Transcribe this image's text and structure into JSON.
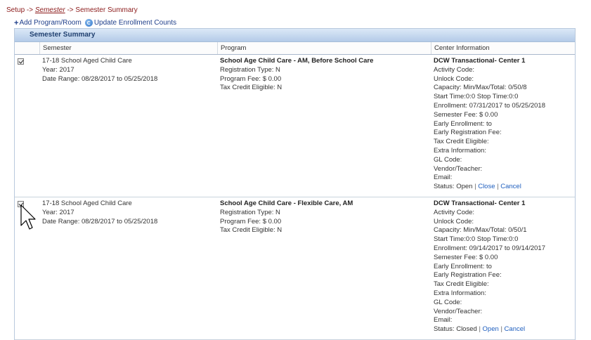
{
  "breadcrumb": {
    "setup": "Setup",
    "sep1": "->",
    "semester": "Semester",
    "sep2": "->",
    "current": "Semester Summary"
  },
  "actions": {
    "add_program": "Add Program/Room",
    "update_counts": "Update Enrollment Counts"
  },
  "panel": {
    "title": "Semester Summary"
  },
  "columns": {
    "semester": "Semester",
    "program": "Program",
    "center": "Center Information"
  },
  "rows": [
    {
      "checked": true,
      "semester": {
        "name": "17-18 School Aged Child Care",
        "year": "Year: 2017",
        "date_range": "Date Range: 08/28/2017 to 05/25/2018"
      },
      "program": {
        "name": "School Age Child Care - AM, Before School Care",
        "registration_type": "Registration Type: N",
        "program_fee": "Program Fee: $ 0.00",
        "tax_credit": "Tax Credit Eligible: N"
      },
      "center": {
        "name": "DCW Transactional- Center 1",
        "activity_code": "Activity Code:",
        "unlock_code": "Unlock Code:",
        "capacity": "Capacity: Min/Max/Total: 0/50/8",
        "times": "Start Time:0:0 Stop Time:0:0",
        "enrollment": "Enrollment: 07/31/2017 to 05/25/2018",
        "semester_fee": "Semester Fee: $ 0.00",
        "early_enrollment": "Early Enrollment: to",
        "early_registration_fee": "Early Registration Fee:",
        "tax_credit": "Tax Credit Eligible:",
        "extra_info": "Extra Information:",
        "gl_code": "GL Code:",
        "vendor": "Vendor/Teacher:",
        "email": "Email:",
        "status": "Status: Open",
        "sep": "|",
        "action1": "Close",
        "action2": "Cancel"
      }
    },
    {
      "checked": true,
      "semester": {
        "name": "17-18 School Aged Child Care",
        "year": "Year: 2017",
        "date_range": "Date Range: 08/28/2017 to 05/25/2018"
      },
      "program": {
        "name": "School Age Child Care - Flexible Care, AM",
        "registration_type": "Registration Type: N",
        "program_fee": "Program Fee: $ 0.00",
        "tax_credit": "Tax Credit Eligible: N"
      },
      "center": {
        "name": "DCW Transactional- Center 1",
        "activity_code": "Activity Code:",
        "unlock_code": "Unlock Code:",
        "capacity": "Capacity: Min/Max/Total: 0/50/1",
        "times": "Start Time:0:0 Stop Time:0:0",
        "enrollment": "Enrollment: 09/14/2017 to 09/14/2017",
        "semester_fee": "Semester Fee: $ 0.00",
        "early_enrollment": "Early Enrollment: to",
        "early_registration_fee": "Early Registration Fee:",
        "tax_credit": "Tax Credit Eligible:",
        "extra_info": "Extra Information:",
        "gl_code": "GL Code:",
        "vendor": "Vendor/Teacher:",
        "email": "Email:",
        "status": "Status: Closed",
        "sep": "|",
        "action1": "Open",
        "action2": "Cancel"
      }
    }
  ]
}
